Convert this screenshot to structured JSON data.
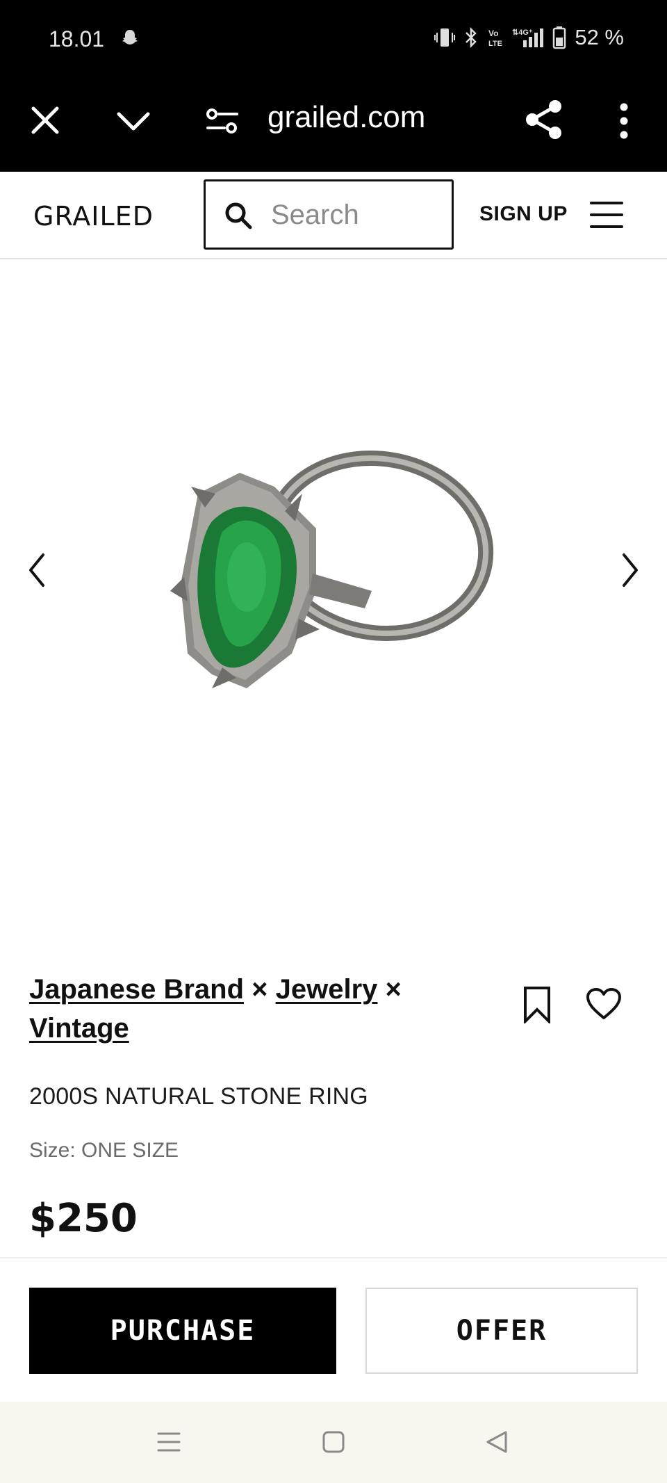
{
  "status_bar": {
    "time": "18.01",
    "battery": "52 %",
    "icons": [
      "snapchat-ghost-icon",
      "vibrate-icon",
      "bluetooth-icon",
      "volte-icon",
      "4g-signal-icon",
      "battery-icon"
    ]
  },
  "browser": {
    "url": "grailed.com",
    "icons": [
      "close-icon",
      "chevron-down-icon",
      "tune-icon",
      "share-icon",
      "more-vert-icon"
    ]
  },
  "header": {
    "logo": "GRAILED",
    "search_placeholder": "Search",
    "signup_label": "SIGN UP"
  },
  "product": {
    "designers": [
      "Japanese Brand",
      "Jewelry",
      "Vintage"
    ],
    "separator": "×",
    "title": "2000S NATURAL STONE RING",
    "size": "Size: ONE SIZE",
    "price": "$250"
  },
  "actions": {
    "purchase_label": "PURCHASE",
    "offer_label": "OFFER"
  },
  "colors": {
    "accent": "#000000",
    "stone_green": "#1f8a3c",
    "metal": "#8e8c88",
    "nav_bg": "#f8f6ee"
  }
}
